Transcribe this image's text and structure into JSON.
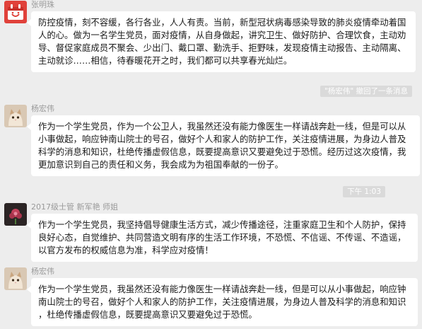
{
  "messages": [
    {
      "sender": "张明珠",
      "lines": [
        "防控疫情，刻不容缓，各行各业，人人有责。当前，新型冠状病毒感染导致的肺炎疫情牵动着国",
        "人的心。做为一名学生党员，面对疫情，从自身做起，讲究卫生、做好防护、合理饮食，主动劝",
        "导、督促家庭成员不聚会、少出门、戴口罩、勤洗手、拒野味，发现疫情主动报告、主动隔离、",
        "主动就诊……相信，待春暖花开之时，我们都可以共享春光灿烂。"
      ]
    },
    {
      "sender": "杨宏伟",
      "lines": [
        "作为一个学生党员，作为一个公卫人，我虽然还没有能力像医生一样请战奔赴一线，但是可以从",
        "小事做起，响应钟南山院士的号召，做好个人和家人的防护工作，关注疫情进展，为身边人普及",
        "科学的消息和知识，杜绝传播虚假信息，既要提高意识又要避免过于恐慌。经历过这次疫情，我",
        "更加意识到自己的责任和义务，我会成为为祖国奉献的一份子。"
      ]
    },
    {
      "sender": "2017级士管  新军艳  师姐",
      "lines": [
        "作为一个学生党员，我坚持倡导健康生活方式，减少传播途径，注重家庭卫生和个人防护，保持",
        "良好心态，自觉维护、共同营造文明有序的生活工作环境，不恐慌、不信谣、不传谣、不造谣，",
        "以官方发布的权威信息为准，科学应对疫情！"
      ]
    },
    {
      "sender": "杨宏伟",
      "lines": [
        "作为一个学生党员，我虽然还没有能力像医生一样请战奔赴一线，但是可以从小事做起，响应钟",
        "南山院士的号召，做好个人和家人的防护工作，关注疫情进展，为身边人普及科学的消息和知识",
        "，杜绝传播虚假信息，既要提高意识又要避免过于恐慌。"
      ]
    }
  ],
  "system": {
    "recall_notice": "\"杨宏伟\" 撤回了一条消息",
    "timestamp": "下午 1:03"
  },
  "colors": {
    "background": "#ededed",
    "bubble": "#ffffff",
    "sender_text": "#9a9a9a",
    "system_pill": "#dadada"
  },
  "icons": [
    "red-calendar-avatar",
    "cat-avatar",
    "dark-flower-avatar",
    "cat-avatar"
  ]
}
